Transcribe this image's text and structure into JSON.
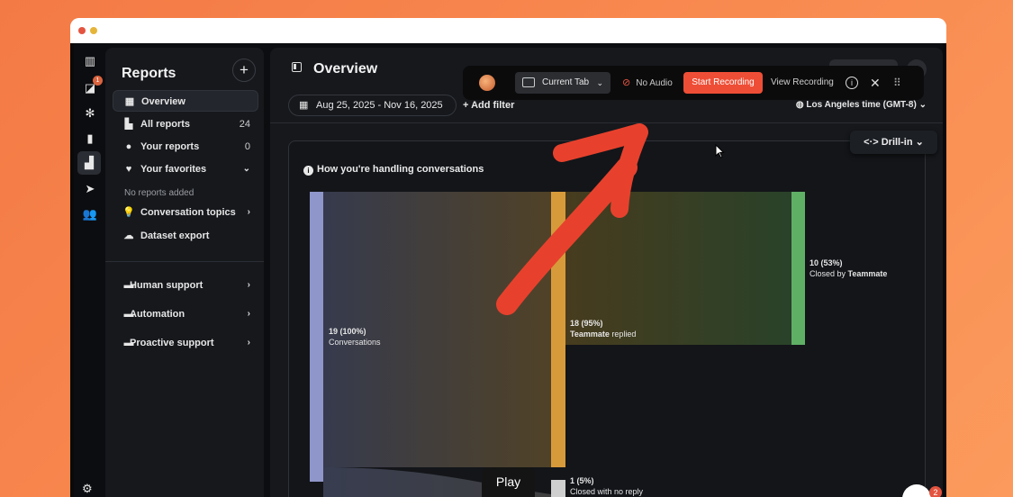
{
  "rail": {
    "icons": [
      "intercom-logo-icon",
      "inbox-icon",
      "fin-icon",
      "knowledge-book-icon",
      "reports-icon",
      "outbound-icon",
      "contacts-icon",
      "settings-icon"
    ],
    "inbox_badge": "1"
  },
  "sidebar": {
    "title": "Reports",
    "items": [
      {
        "label": "Overview",
        "icon": "grid-icon"
      },
      {
        "label": "All reports",
        "icon": "bar-chart-icon",
        "count": "24"
      },
      {
        "label": "Your reports",
        "icon": "user-icon",
        "count": "0"
      },
      {
        "label": "Your favorites",
        "icon": "heart-icon"
      },
      {
        "label": "Conversation topics",
        "icon": "lightbulb-icon"
      },
      {
        "label": "Dataset export",
        "icon": "cloud-icon"
      }
    ],
    "no_reports_note": "No reports added",
    "folders": [
      {
        "label": "Human support"
      },
      {
        "label": "Automation"
      },
      {
        "label": "Proactive support"
      }
    ]
  },
  "main": {
    "title": "Overview",
    "date_range": "Aug 25, 2025 - Nov 16, 2025",
    "add_filter": "+ Add filter",
    "timezone": "Los Angeles time (GMT-8)",
    "drill_in": "Drill-in",
    "card_title": "How you're handling conversations"
  },
  "sankey": {
    "nodes": [
      {
        "value": "19 (100%)",
        "label": "Conversations",
        "color": "#8f96c9"
      },
      {
        "value": "18 (95%)",
        "label_bold": "Teammate",
        "label_rest": " replied",
        "color": "#d79a3a"
      },
      {
        "value": "10 (53%)",
        "label_pre": "Closed by ",
        "label_bold": "Teammate",
        "color": "#5fb065"
      },
      {
        "value": "1 (5%)",
        "label": "Closed with no reply",
        "color": "#cfcfcf"
      }
    ]
  },
  "recorder": {
    "tab_select": "Current Tab",
    "audio": "No Audio",
    "start": "Start Recording",
    "view": "View Recording",
    "accent": "#ef4e36"
  },
  "player": {
    "play_label": "Play",
    "chat_badge": "2"
  }
}
